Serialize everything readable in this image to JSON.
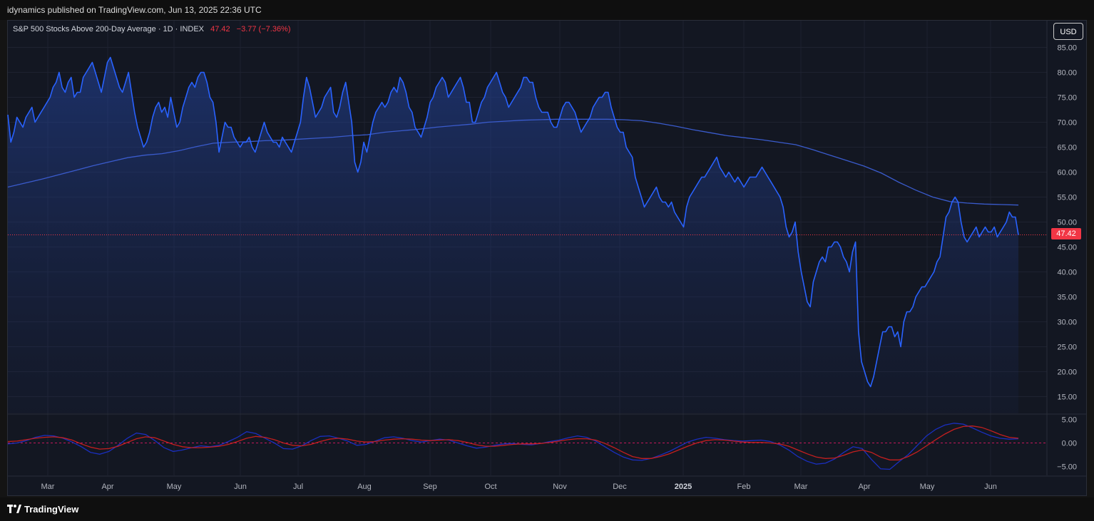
{
  "header": {
    "published": "idynamics published on TradingView.com, Jun 13, 2025 22:36 UTC"
  },
  "legend": {
    "symbol": "S&P 500 Stocks Above 200-Day Average · 1D · INDEX",
    "last": "47.42",
    "change": "−3.77 (−7.36%)"
  },
  "currency_button": "USD",
  "last_price_label": "47.42",
  "footer": {
    "brand": "TradingView"
  },
  "colors": {
    "background": "#131722",
    "price_line": "#2962ff",
    "ma_line": "#3a5bcc",
    "area_fill_top": "#1e3a8a",
    "osc_signal": "#c41f1f",
    "osc_macd": "#1a2fbf",
    "last_price": "#f23645"
  },
  "chart_data": [
    {
      "type": "line",
      "panel": "main",
      "y_axis_ticks": [
        "85.00",
        "80.00",
        "75.00",
        "70.00",
        "65.00",
        "60.00",
        "55.00",
        "50.00",
        "45.00",
        "40.00",
        "35.00",
        "30.00",
        "25.00",
        "20.00",
        "15.00"
      ],
      "ylim": [
        10.5,
        88.5
      ],
      "x_axis_ticks": [
        "Mar",
        "Apr",
        "May",
        "Jun",
        "Jul",
        "Aug",
        "Sep",
        "Oct",
        "Nov",
        "Dec",
        "2025",
        "Feb",
        "Mar",
        "Apr",
        "May",
        "Jun"
      ],
      "last_value": 47.42,
      "series": [
        {
          "role": "price",
          "values": [
            71.5,
            66,
            68,
            71,
            70,
            69,
            71,
            72,
            73,
            70,
            71,
            72,
            73,
            74,
            75,
            77,
            78,
            80,
            77,
            76,
            78,
            79,
            75,
            76,
            76,
            79,
            80,
            81,
            82,
            80,
            78,
            76,
            79,
            82,
            83,
            81,
            79,
            77,
            76,
            78,
            80,
            76,
            72,
            69,
            67,
            65,
            66,
            68,
            71,
            73,
            74,
            72,
            73,
            71,
            75,
            72,
            69,
            70,
            73,
            75,
            77,
            78,
            77,
            79,
            80,
            80,
            78,
            75,
            74,
            70,
            64,
            67,
            70,
            69,
            69,
            67,
            66,
            65,
            66,
            66,
            67,
            65,
            64,
            66,
            68,
            70,
            68,
            67,
            66,
            66,
            65,
            67,
            66,
            65,
            64,
            66,
            68,
            70,
            75,
            79,
            77,
            74,
            71,
            72,
            73,
            75,
            76,
            77,
            72,
            71,
            73,
            76,
            78,
            74,
            70,
            62,
            60,
            62,
            66,
            64,
            67,
            70,
            72,
            73,
            74,
            73,
            74,
            76,
            77,
            76,
            79,
            78,
            76,
            73,
            72,
            69,
            68,
            67,
            69,
            71,
            74,
            75,
            77,
            78,
            79,
            78,
            75,
            76,
            77,
            78,
            79,
            77,
            74,
            74,
            70,
            70,
            72,
            74,
            75,
            77,
            78,
            79,
            80,
            78,
            76,
            75,
            73,
            74,
            75,
            76,
            77,
            79,
            79,
            78,
            78,
            75,
            73,
            72,
            72,
            72,
            70,
            69,
            69,
            71,
            73,
            74,
            74,
            73,
            72,
            70,
            68,
            69,
            70,
            71,
            73,
            74,
            75,
            75,
            76,
            76,
            73,
            71,
            69,
            68,
            68,
            65,
            64,
            63,
            59,
            57,
            55,
            53,
            54,
            55,
            56,
            57,
            55,
            54,
            54,
            53,
            54,
            52,
            51,
            50,
            49,
            53,
            55,
            56,
            57,
            58,
            59,
            59,
            60,
            61,
            62,
            63,
            61,
            60,
            59,
            60,
            59,
            58,
            59,
            58,
            57,
            58,
            59,
            59,
            59,
            60,
            61,
            60,
            59,
            58,
            57,
            56,
            55,
            53,
            49,
            47,
            48,
            50,
            44,
            40,
            37,
            34,
            33,
            38,
            40,
            42,
            43,
            42,
            45,
            45,
            46,
            46,
            45,
            43,
            42,
            40,
            44,
            46,
            28,
            22,
            20,
            18,
            17,
            19,
            22,
            25,
            28,
            28,
            29,
            29,
            27,
            28,
            25,
            30,
            32,
            32,
            33,
            35,
            36,
            37,
            37,
            38,
            39,
            40,
            42,
            43,
            47,
            51,
            52,
            54,
            55,
            54,
            50,
            47,
            46,
            47,
            48,
            49,
            47,
            48,
            49,
            48,
            48,
            49,
            47,
            48,
            49,
            50,
            52,
            51,
            51,
            47.42
          ]
        },
        {
          "role": "moving_average",
          "name": "200-Day Average",
          "values": [
            57,
            57.8,
            58.6,
            59.5,
            60.4,
            61.3,
            62.1,
            62.9,
            63.4,
            63.7,
            64.3,
            65.1,
            65.8,
            66,
            66.1,
            66.3,
            66.4,
            66.6,
            66.8,
            67,
            67.3,
            67.5,
            68,
            68.3,
            68.6,
            69,
            69.3,
            69.6,
            70,
            70.2,
            70.4,
            70.5,
            70.6,
            70.6,
            70.6,
            70.6,
            70.5,
            70.3,
            69.8,
            69.2,
            68.5,
            67.9,
            67.3,
            66.9,
            66.5,
            66,
            65.5,
            64.5,
            63.4,
            62.3,
            61.2,
            59.8,
            58,
            56.4,
            55,
            54.1,
            53.8,
            53.6,
            53.5,
            53.4
          ]
        }
      ]
    },
    {
      "type": "line",
      "panel": "oscillator",
      "y_axis_ticks": [
        "5.00",
        "0.00",
        "−5.00"
      ],
      "ylim": [
        -7,
        7
      ],
      "series": [
        {
          "role": "macd",
          "values": [
            -0.2,
            0,
            0.5,
            1.2,
            1.6,
            1.5,
            1,
            0.2,
            -0.8,
            -2,
            -2.4,
            -1.8,
            -0.5,
            1,
            2.1,
            1.8,
            0.5,
            -1,
            -1.8,
            -1.5,
            -1,
            -0.6,
            -0.8,
            -0.5,
            0.3,
            1.2,
            2.4,
            2,
            1,
            0,
            -1.2,
            -1.3,
            -0.6,
            0.5,
            1.4,
            1.5,
            1,
            0.4,
            -0.5,
            -0.3,
            0.4,
            1.1,
            1.3,
            1,
            0.5,
            0.2,
            0.5,
            0.8,
            0.6,
            0,
            -0.6,
            -1.1,
            -0.9,
            -0.5,
            -0.2,
            -0.1,
            -0.3,
            -0.4,
            -0.1,
            0.3,
            0.6,
            1.1,
            1.5,
            1.2,
            0.4,
            -0.8,
            -2,
            -3,
            -3.6,
            -3.7,
            -3.3,
            -2.6,
            -1.8,
            -0.8,
            0.2,
            0.8,
            1.2,
            1,
            0.7,
            0.5,
            0.4,
            0.5,
            0.6,
            0.3,
            -0.4,
            -1.5,
            -2.9,
            -3.9,
            -4.5,
            -4.3,
            -3.4,
            -2,
            -0.8,
            -1.2,
            -3.5,
            -5.5,
            -5.6,
            -4,
            -2.5,
            -0.5,
            1.5,
            2.9,
            3.8,
            4.2,
            4,
            3.2,
            2.3,
            1.5,
            1,
            0.8,
            0.9
          ]
        },
        {
          "role": "signal",
          "values": [
            0.3,
            0.4,
            0.7,
            1,
            1.2,
            1.3,
            1.1,
            0.6,
            -0.2,
            -0.9,
            -1.3,
            -1.2,
            -0.7,
            0.1,
            0.9,
            1.3,
            1.1,
            0.4,
            -0.3,
            -0.8,
            -1,
            -1,
            -0.9,
            -0.7,
            -0.3,
            0.3,
            1,
            1.4,
            1.2,
            0.7,
            0,
            -0.5,
            -0.6,
            -0.3,
            0.3,
            0.8,
            1,
            0.8,
            0.4,
            0.2,
            0.3,
            0.6,
            0.8,
            0.9,
            0.8,
            0.6,
            0.5,
            0.6,
            0.7,
            0.5,
            0.1,
            -0.4,
            -0.7,
            -0.7,
            -0.5,
            -0.3,
            -0.2,
            -0.2,
            -0.1,
            0.1,
            0.4,
            0.7,
            0.9,
            0.9,
            0.6,
            -0.1,
            -1,
            -2,
            -2.9,
            -3.3,
            -3.3,
            -2.9,
            -2.3,
            -1.5,
            -0.7,
            0,
            0.5,
            0.7,
            0.6,
            0.4,
            0.2,
            0.1,
            0.1,
            0,
            -0.2,
            -0.7,
            -1.5,
            -2.3,
            -3,
            -3.3,
            -3.2,
            -2.6,
            -1.9,
            -1.5,
            -2,
            -3,
            -3.6,
            -3.6,
            -2.9,
            -1.9,
            -0.6,
            0.7,
            1.9,
            2.9,
            3.5,
            3.6,
            3.3,
            2.6,
            1.8,
            1.2,
            1
          ]
        }
      ]
    }
  ]
}
